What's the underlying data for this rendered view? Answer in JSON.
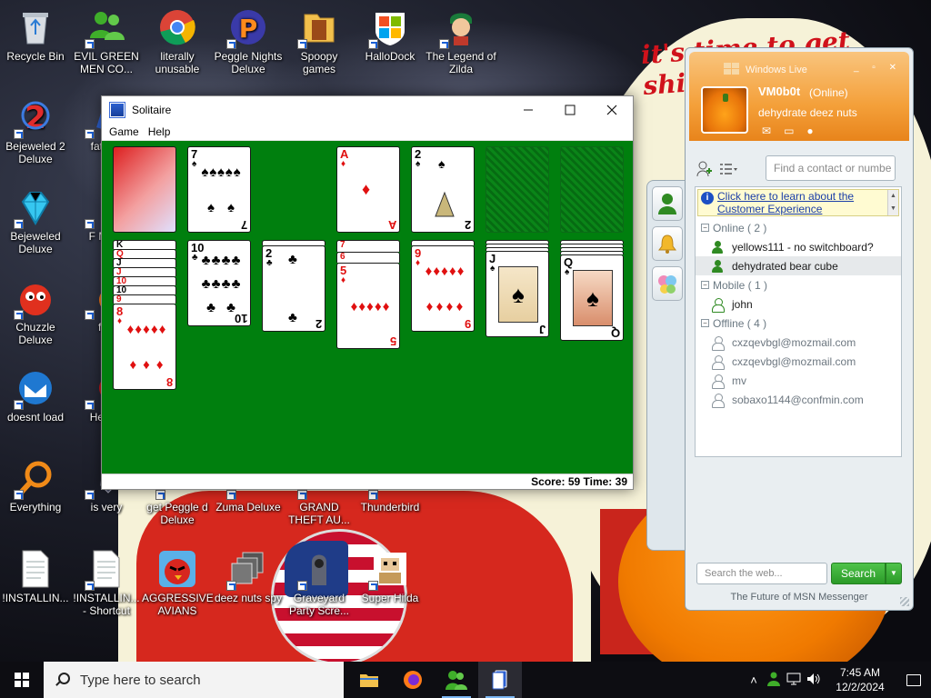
{
  "desktop": {
    "icons": [
      {
        "label": "Recycle Bin"
      },
      {
        "label": "EVIL GREEN MEN CO..."
      },
      {
        "label": "literally unusable"
      },
      {
        "label": "Peggle Nights Deluxe"
      },
      {
        "label": "Spoopy games"
      },
      {
        "label": "HalloDock"
      },
      {
        "label": "The Legend of Zilda"
      },
      {
        "label": "Bejeweled 2 Deluxe"
      },
      {
        "label": "fat like"
      },
      {
        "label": "Bejeweled Deluxe"
      },
      {
        "label": "F MON"
      },
      {
        "label": "Chuzzle Deluxe"
      },
      {
        "label": "furr"
      },
      {
        "label": "doesnt load"
      },
      {
        "label": "He We"
      },
      {
        "label": "Everything"
      },
      {
        "label": "is very"
      },
      {
        "label": "get Peggle d Deluxe"
      },
      {
        "label": "Zuma Deluxe"
      },
      {
        "label": "GRAND THEFT AU..."
      },
      {
        "label": "Thunderbird"
      },
      {
        "label": "!INSTALLIN..."
      },
      {
        "label": "!INSTALLIN... - Shortcut"
      },
      {
        "label": "AGGRESSIVE AVIANS"
      },
      {
        "label": "deez nuts spy"
      },
      {
        "label": "Graveyard Party Scre..."
      },
      {
        "label": "Super Hilda"
      }
    ],
    "wallpaper_text": "it's time to get shit and or t"
  },
  "solitaire": {
    "title": "Solitaire",
    "menu": [
      "Game",
      "Help"
    ],
    "status": "Score: 59 Time: 39",
    "colors": {
      "felt": "#007f0e"
    },
    "top_row": {
      "waste": {
        "rank": "7",
        "suit": "♠"
      },
      "foundations": [
        {
          "rank": "A",
          "suit": "♦"
        },
        {
          "rank": "2",
          "suit": "♠"
        }
      ]
    },
    "tableau": [
      {
        "stack_labels": [
          "K",
          "Q",
          "J",
          "J",
          "10",
          "10",
          "9"
        ],
        "top": {
          "rank": "8",
          "suit": "♦"
        }
      },
      {
        "stack_labels": [],
        "top": {
          "rank": "10",
          "suit": "♣"
        }
      },
      {
        "stack_labels": [],
        "top": {
          "rank": "2",
          "suit": "♣"
        }
      },
      {
        "stack_labels": [
          "7",
          "6"
        ],
        "top": {
          "rank": "5",
          "suit": "♦"
        }
      },
      {
        "stack_labels": [],
        "top": {
          "rank": "9",
          "suit": "♦"
        }
      },
      {
        "stack_labels": [],
        "top": {
          "rank": "J",
          "suit": "♠"
        }
      },
      {
        "stack_labels": [],
        "top": {
          "rank": "Q",
          "suit": "♠"
        }
      }
    ]
  },
  "messenger": {
    "window_title": "Windows Live",
    "user": {
      "name": "VM0b0t",
      "status": "(Online)",
      "personal_message": "dehydrate deez nuts"
    },
    "find_placeholder": "Find a contact or numbe",
    "banner": "Click here to learn about the Customer Experience",
    "groups": [
      {
        "label": "Online ( 2 )",
        "contacts": [
          {
            "name": "yellows111 - no switchboard?",
            "state": "online"
          },
          {
            "name": "dehydrated bear cube",
            "state": "online",
            "selected": true
          }
        ]
      },
      {
        "label": "Mobile ( 1 )",
        "contacts": [
          {
            "name": "john",
            "state": "mobile"
          }
        ]
      },
      {
        "label": "Offline ( 4 )",
        "contacts": [
          {
            "name": "cxzqevbgl@mozmail.com",
            "state": "offline"
          },
          {
            "name": "cxzqevbgl@mozmail.com",
            "state": "offline"
          },
          {
            "name": "mv",
            "state": "offline"
          },
          {
            "name": "sobaxo1144@confmin.com",
            "state": "offline"
          }
        ]
      }
    ],
    "search_placeholder": "Search the web...",
    "search_button": "Search",
    "footer": "The Future of MSN Messenger",
    "colors": {
      "header": "#f4a03a",
      "online": "#2f8a22",
      "offline": "#8c969e",
      "search": "#2b9a28"
    }
  },
  "taskbar": {
    "search_placeholder": "Type here to search",
    "time": "7:45 AM",
    "date": "12/2/2024",
    "pinned": [
      "file-explorer-icon",
      "firefox-icon",
      "messenger-icon",
      "solitaire-icon"
    ]
  }
}
